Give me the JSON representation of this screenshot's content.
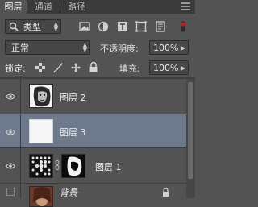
{
  "tabs": [
    {
      "label": "图层",
      "active": true
    },
    {
      "label": "通道",
      "active": false
    },
    {
      "label": "路径",
      "active": false
    }
  ],
  "filter": {
    "kind_label": "类型",
    "icons": [
      "image-filter-icon",
      "adjustment-filter-icon",
      "type-filter-icon",
      "shape-filter-icon",
      "smart-object-filter-icon"
    ]
  },
  "blend": {
    "mode": "正常",
    "opacity_label": "不透明度:",
    "opacity_value": "100%"
  },
  "lock": {
    "label": "锁定:",
    "fill_label": "填充:",
    "fill_value": "100%"
  },
  "layers": [
    {
      "name": "图层 2",
      "visible": true,
      "selected": false
    },
    {
      "name": "图层 3",
      "visible": true,
      "selected": true
    },
    {
      "name": "图层 1",
      "visible": true,
      "selected": false
    },
    {
      "name": "背景",
      "visible": false,
      "selected": false
    }
  ],
  "colors": {
    "panel_bg": "#535353",
    "tabbar_bg": "#3a3a3a",
    "selected_row": "#6e7a8b"
  }
}
